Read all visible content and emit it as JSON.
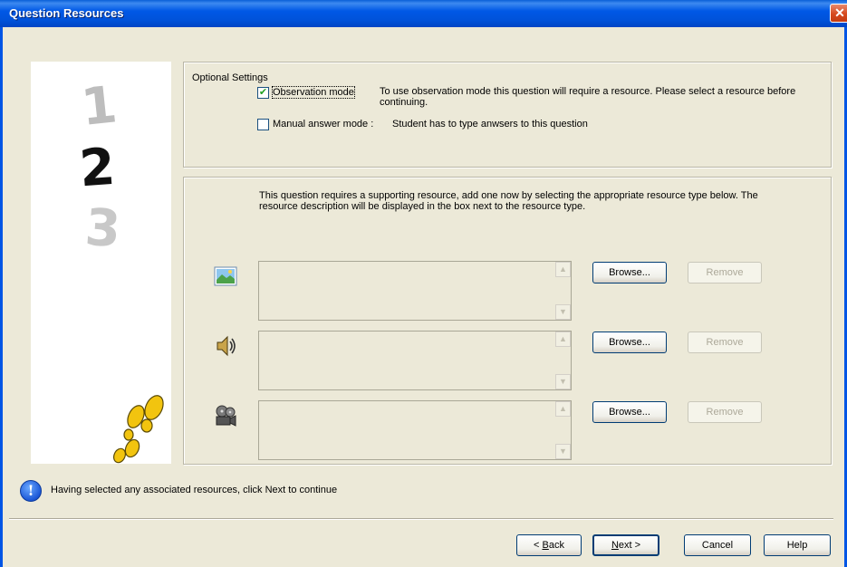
{
  "window": {
    "title": "Question Resources",
    "close_symbol": "✕"
  },
  "steps": [
    "1",
    "2",
    "3"
  ],
  "optional_settings": {
    "label": "Optional Settings",
    "observation": {
      "label": "Observation mode",
      "checked": true,
      "check_glyph": "✔",
      "description": "To use observation mode this question will require a resource. Please select a resource before continuing."
    },
    "manual": {
      "label": "Manual answer mode :",
      "checked": false,
      "description": "Student has to type anwsers to this question"
    }
  },
  "resources": {
    "intro": "This question requires a supporting resource, add one now by selecting the appropriate resource type below. The resource description will be displayed in the box next to the resource type.",
    "rows": [
      {
        "icon": "image-icon",
        "browse_label": "Browse...",
        "remove_label": "Remove"
      },
      {
        "icon": "speaker-icon",
        "browse_label": "Browse...",
        "remove_label": "Remove"
      },
      {
        "icon": "film-reel-icon",
        "browse_label": "Browse...",
        "remove_label": "Remove"
      }
    ],
    "scroll_up": "▲",
    "scroll_down": "▼"
  },
  "info": {
    "text": "Having selected any associated resources, click Next to continue",
    "icon_glyph": "!"
  },
  "footer": {
    "back_prefix": "< ",
    "back_key": "B",
    "back_rest": "ack",
    "next_key": "N",
    "next_rest": "ext >",
    "cancel": "Cancel",
    "help": "Help"
  },
  "colors": {
    "titlebar": "#0058e6",
    "face": "#ece9d8",
    "button_border": "#003c74",
    "disabled_text": "#aca899"
  }
}
